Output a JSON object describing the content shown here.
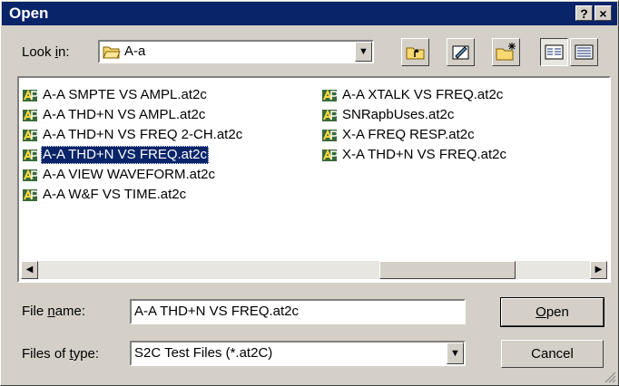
{
  "window": {
    "title": "Open",
    "help_label": "?",
    "close_label": "×"
  },
  "lookin": {
    "label_pre": "Look ",
    "label_u": "i",
    "label_post": "n:",
    "value": "A-a"
  },
  "toolbar": {
    "icons": [
      "up-folder-icon",
      "desktop-icon",
      "new-folder-icon",
      "list-view-icon",
      "details-view-icon"
    ]
  },
  "files": [
    "A-A SMPTE VS AMPL.at2c",
    "A-A THD+N VS AMPL.at2c",
    "A-A THD+N VS FREQ 2-CH.at2c",
    "A-A THD+N VS FREQ.at2c",
    "A-A VIEW WAVEFORM.at2c",
    "A-A W&F VS TIME.at2c",
    "A-A XTALK VS FREQ.at2c",
    "SNRapbUses.at2c",
    "X-A FREQ RESP.at2c",
    "X-A THD+N VS FREQ.at2c"
  ],
  "selected_file": "A-A THD+N VS FREQ.at2c",
  "filename": {
    "label_pre": "File ",
    "label_u": "n",
    "label_post": "ame:",
    "value": "A-A THD+N VS FREQ.at2c"
  },
  "filetype": {
    "label_pre": "Files of ",
    "label_u": "t",
    "label_post": "ype:",
    "value": "S2C Test Files (*.at2C)"
  },
  "buttons": {
    "open_u": "O",
    "open_rest": "pen",
    "cancel": "Cancel"
  },
  "colors": {
    "selection": "#0a246a",
    "face": "#d4d0c8",
    "title": "#0a246a"
  }
}
